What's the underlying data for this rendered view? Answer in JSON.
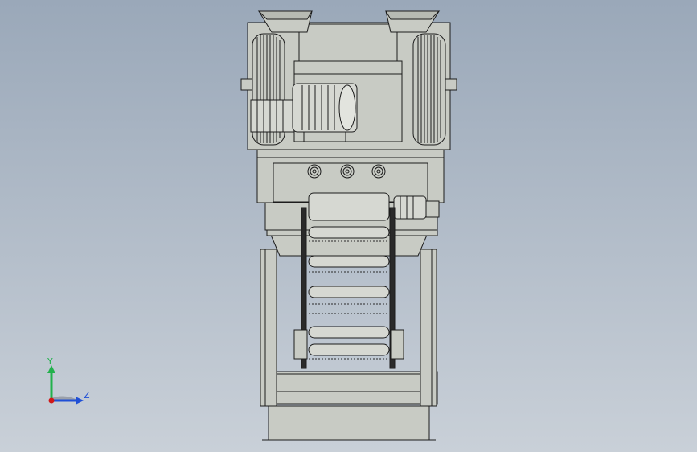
{
  "viewport": {
    "background_top": "#9aa8b9",
    "background_bottom": "#c9d0d8"
  },
  "model": {
    "fill": "#c8cbc4",
    "stroke": "#1c1c1c",
    "dark": "#2a2a2a",
    "roller_fill": "#d6d8d2"
  },
  "triad": {
    "y_label": "Y",
    "z_label": "Z",
    "y_color": "#22b14c",
    "z_color": "#1f4fd6",
    "x_color": "#d01818"
  }
}
